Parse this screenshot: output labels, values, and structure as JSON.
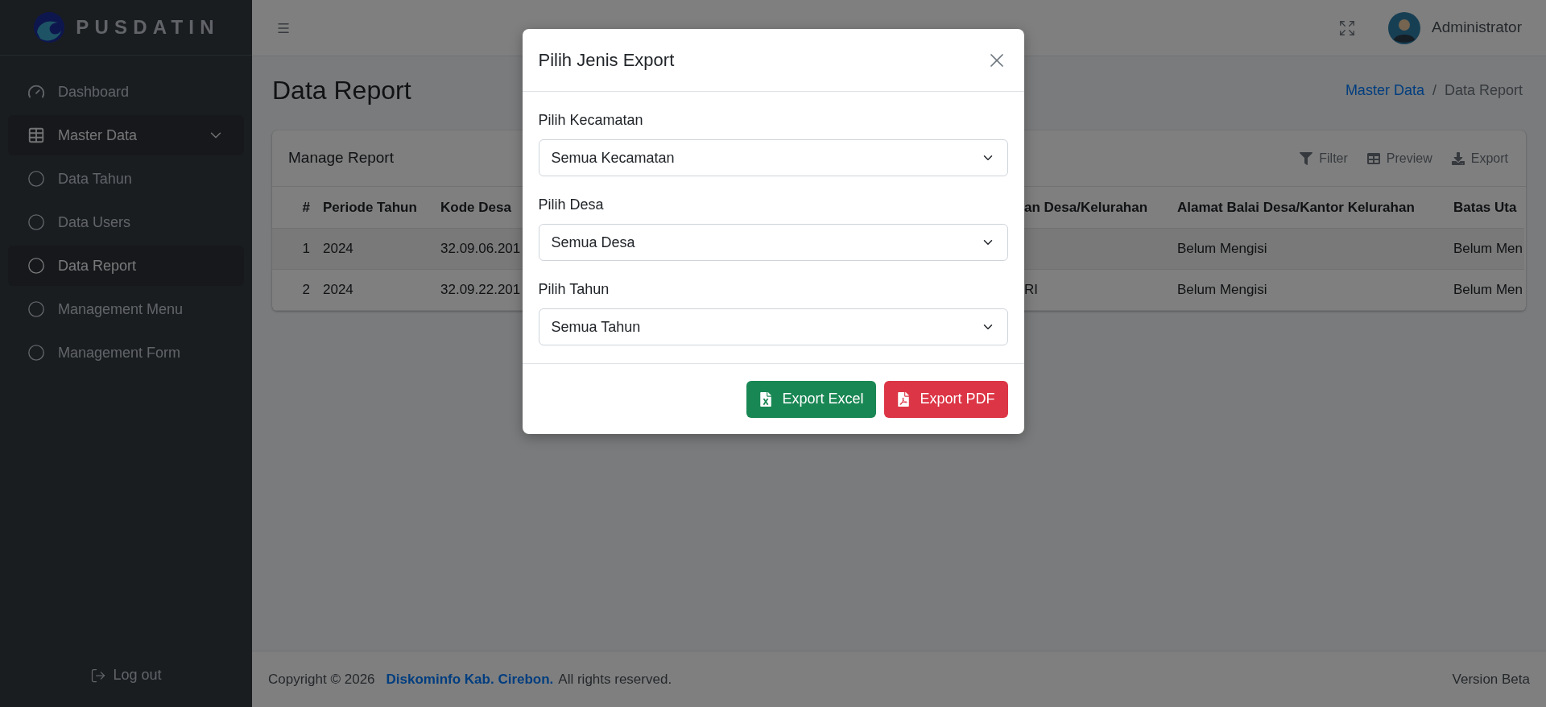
{
  "sidebar": {
    "brand": "PUSDATIN",
    "items": [
      {
        "label": "Dashboard",
        "kind": "gauge",
        "selected": false
      },
      {
        "label": "Master Data",
        "kind": "table",
        "expanded": true,
        "children": [
          {
            "label": "Data Tahun",
            "kind": "circle",
            "selected": false
          },
          {
            "label": "Data Users",
            "kind": "circle",
            "selected": false
          },
          {
            "label": "Data Report",
            "kind": "circle",
            "selected": true
          },
          {
            "label": "Management Menu",
            "kind": "circle",
            "selected": false
          },
          {
            "label": "Management Form",
            "kind": "circle",
            "selected": false
          }
        ]
      }
    ],
    "logout": "Log out"
  },
  "header": {
    "user_name": "Administrator"
  },
  "page": {
    "title": "Data Report",
    "breadcrumb": [
      {
        "label": "Master Data",
        "kind": "link"
      },
      {
        "label": "/",
        "kind": "separator"
      },
      {
        "label": "Data Report",
        "kind": "current"
      }
    ]
  },
  "card": {
    "title": "Manage Report",
    "tools": [
      {
        "label": "Filter",
        "kind": "filter"
      },
      {
        "label": "Preview",
        "kind": "table"
      },
      {
        "label": "Export",
        "kind": "download"
      }
    ],
    "table": {
      "columns": [
        "#",
        "Periode Tahun",
        "Kode Desa",
        "an Desa/Kelurahan",
        "Alamat Balai Desa/Kantor Kelurahan",
        "Batas Uta"
      ],
      "rows": [
        [
          "1",
          "2024",
          "32.09.06.201",
          "",
          "Belum Mengisi",
          "Belum Men"
        ],
        [
          "2",
          "2024",
          "32.09.22.201",
          "RI",
          "Belum Mengisi",
          "Belum Men"
        ]
      ]
    }
  },
  "modal": {
    "title": "Pilih Jenis Export",
    "fields": [
      {
        "label": "Pilih Kecamatan",
        "value": "Semua Kecamatan"
      },
      {
        "label": "Pilih Desa",
        "value": "Semua Desa"
      },
      {
        "label": "Pilih Tahun",
        "value": "Semua Tahun"
      }
    ],
    "buttons": [
      {
        "label": "Export Excel",
        "kind": "excel"
      },
      {
        "label": "Export PDF",
        "kind": "pdf"
      }
    ]
  },
  "footer": {
    "copyright": "Copyright © 2026",
    "link": "Diskominfo Kab. Cirebon.",
    "rights": "All rights reserved.",
    "version": "Version Beta"
  }
}
